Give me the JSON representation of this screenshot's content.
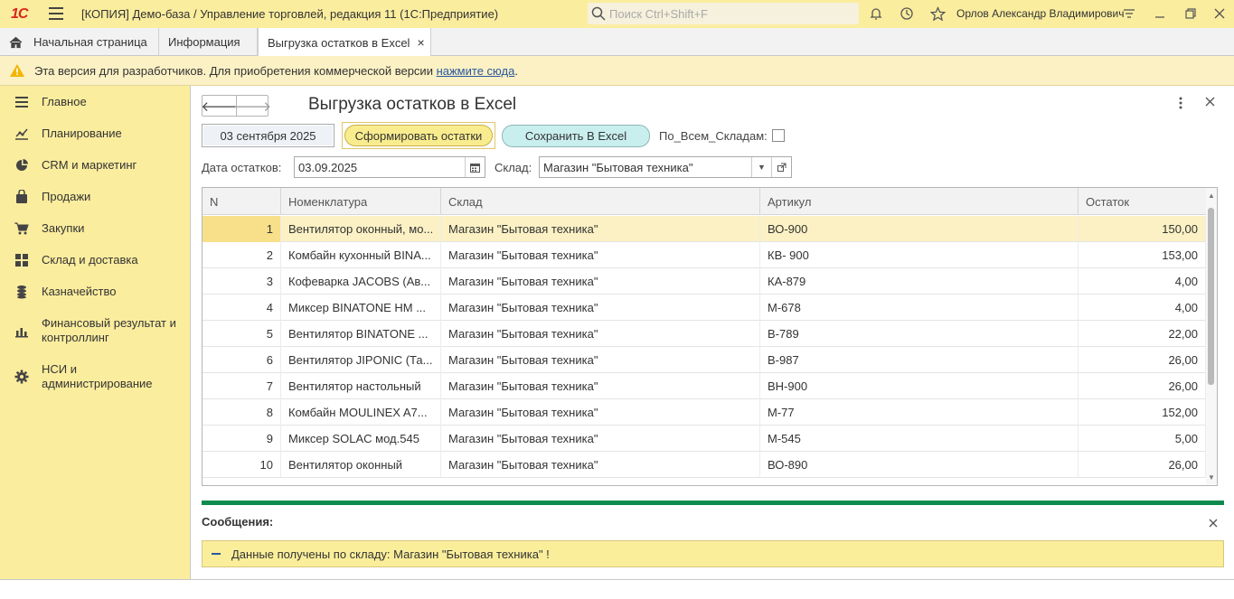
{
  "app": {
    "logo": "1С",
    "title": "[КОПИЯ] Демо-база / Управление торговлей, редакция 11  (1С:Предприятие)",
    "search_placeholder": "Поиск Ctrl+Shift+F",
    "user": "Орлов Александр Владимирович"
  },
  "tabs": [
    {
      "label": "Начальная страница"
    },
    {
      "label": "Информация"
    },
    {
      "label": "Выгрузка остатков в Excel",
      "close": "×"
    }
  ],
  "banner": {
    "text": "Эта версия для разработчиков. Для приобретения коммерческой версии ",
    "link": "нажмите сюда",
    "tail": "."
  },
  "sidebar": {
    "items": [
      {
        "label": "Главное",
        "icon": "menu-lines-icon"
      },
      {
        "label": "Планирование",
        "icon": "chart-trend-icon"
      },
      {
        "label": "CRM и маркетинг",
        "icon": "pie-chart-icon"
      },
      {
        "label": "Продажи",
        "icon": "bag-icon"
      },
      {
        "label": "Закупки",
        "icon": "cart-icon"
      },
      {
        "label": "Склад и доставка",
        "icon": "grid-icon"
      },
      {
        "label": "Казначейство",
        "icon": "coins-icon"
      },
      {
        "label": "Финансовый результат и контроллинг",
        "icon": "bar-chart-icon"
      },
      {
        "label": "НСИ и администрирование",
        "icon": "gear-icon"
      }
    ]
  },
  "form": {
    "title": "Выгрузка остатков в Excel",
    "back": "🡐",
    "forward": "🡒",
    "date_button": "03 сентября 2025",
    "generate_button": "Сформировать остатки",
    "excel_button": "Сохранить В Excel",
    "all_warehouses_label": "По_Всем_Складам:",
    "date_label": "Дата остатков:",
    "date_value": "03.09.2025",
    "warehouse_label": "Склад:",
    "warehouse_value": "Магазин \"Бытовая техника\""
  },
  "table": {
    "columns": [
      "N",
      "Номенклатура",
      "Склад",
      "Артикул",
      "Остаток"
    ],
    "rows": [
      {
        "n": "1",
        "name": "Вентилятор оконный, мо...",
        "wh": "Магазин \"Бытовая техника\"",
        "sku": "ВО-900",
        "qty": "150,00"
      },
      {
        "n": "2",
        "name": "Комбайн кухонный BINA...",
        "wh": "Магазин \"Бытовая техника\"",
        "sku": "КВ- 900",
        "qty": "153,00"
      },
      {
        "n": "3",
        "name": "Кофеварка JACOBS (Ав...",
        "wh": "Магазин \"Бытовая техника\"",
        "sku": "КА-879",
        "qty": "4,00"
      },
      {
        "n": "4",
        "name": "Миксер BINATONE HM ...",
        "wh": "Магазин \"Бытовая техника\"",
        "sku": "М-678",
        "qty": "4,00"
      },
      {
        "n": "5",
        "name": "Вентилятор BINATONE ...",
        "wh": "Магазин \"Бытовая техника\"",
        "sku": "В-789",
        "qty": "22,00"
      },
      {
        "n": "6",
        "name": "Вентилятор JIPONIC (Та...",
        "wh": "Магазин \"Бытовая техника\"",
        "sku": "В-987",
        "qty": "26,00"
      },
      {
        "n": "7",
        "name": "Вентилятор настольный",
        "wh": "Магазин \"Бытовая техника\"",
        "sku": "ВН-900",
        "qty": "26,00"
      },
      {
        "n": "8",
        "name": "Комбайн MOULINEX A7...",
        "wh": "Магазин \"Бытовая техника\"",
        "sku": "М-77",
        "qty": "152,00"
      },
      {
        "n": "9",
        "name": "Миксер SOLAC мод.545",
        "wh": "Магазин \"Бытовая техника\"",
        "sku": "М-545",
        "qty": "5,00"
      },
      {
        "n": "10",
        "name": "Вентилятор оконный",
        "wh": "Магазин \"Бытовая техника\"",
        "sku": "ВО-890",
        "qty": "26,00"
      }
    ]
  },
  "messages": {
    "title": "Сообщения:",
    "text": "Данные получены по складу: Магазин \"Бытовая техника\" !"
  },
  "colors": {
    "header_bg": "#fbed9e",
    "selected_row": "#fbf1c4",
    "message_accent": "#0e8a4e",
    "link": "#2a57a0"
  }
}
